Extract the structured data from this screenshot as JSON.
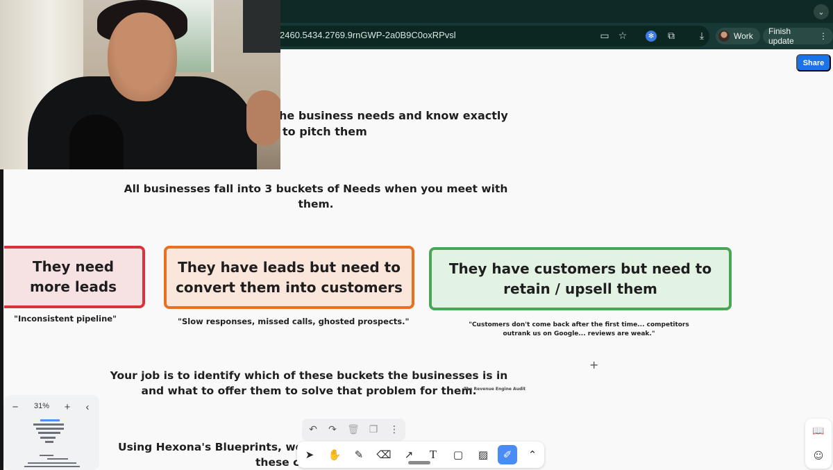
{
  "browser": {
    "url": "2460.5434.2769.9rnGWP-2a0B9C0oxRPvsl",
    "profile_label": "Work",
    "update_label": "Finish update",
    "icons": [
      "cast-icon",
      "bookmark-star-icon",
      "extension-blue-icon",
      "puzzle-extensions-icon",
      "download-icon",
      "kebab-menu-icon",
      "tab-search-chevron-icon"
    ]
  },
  "board": {
    "share_label": "Share",
    "heading_partial_1": "he business needs and know",
    "heading_partial_bold": "exactly",
    "heading_partial_2": "to pitch them",
    "intro_line_1": "All businesses fall into 3 buckets of Needs when you meet with",
    "intro_line_2": "them.",
    "buckets": [
      {
        "title": "They need more leads",
        "quote": "\"Inconsistent pipeline\""
      },
      {
        "title": "They have leads but need to convert them into customers",
        "quote": "\"Slow responses, missed calls, ghosted prospects.\""
      },
      {
        "title": "They have customers but need to retain / upsell them",
        "quote": "\"Customers don't come back after the first time... competitors outrank us on Google... reviews are weak.\""
      }
    ],
    "job_line_1": "Your job is to identify which of these buckets the businesses is in",
    "job_line_2": "and what to offer them to solve that problem for them.",
    "tiny_label": "The Revenue Engine Audit",
    "blueprint_line_1": "Using Hexona's Blueprints, we l",
    "blueprint_line_2": "these c"
  },
  "zoom": {
    "level": "31%",
    "minus": "−",
    "plus": "+",
    "collapse": "‹"
  },
  "history_toolbar": [
    "undo-icon",
    "redo-icon",
    "delete-icon",
    "duplicate-icon",
    "more-icon"
  ],
  "tools": [
    "select-pointer-icon",
    "hand-pan-icon",
    "pencil-icon",
    "eraser-icon",
    "arrow-icon",
    "text-icon",
    "sticky-note-icon",
    "image-icon",
    "marker-icon",
    "chevron-up-icon"
  ],
  "active_tool": "marker",
  "colors": {
    "share_blue": "#1a73e8",
    "red_border": "#d9323c",
    "orange_border": "#e8701f",
    "green_border": "#4aa657",
    "active_tool": "#4a8cf5"
  }
}
